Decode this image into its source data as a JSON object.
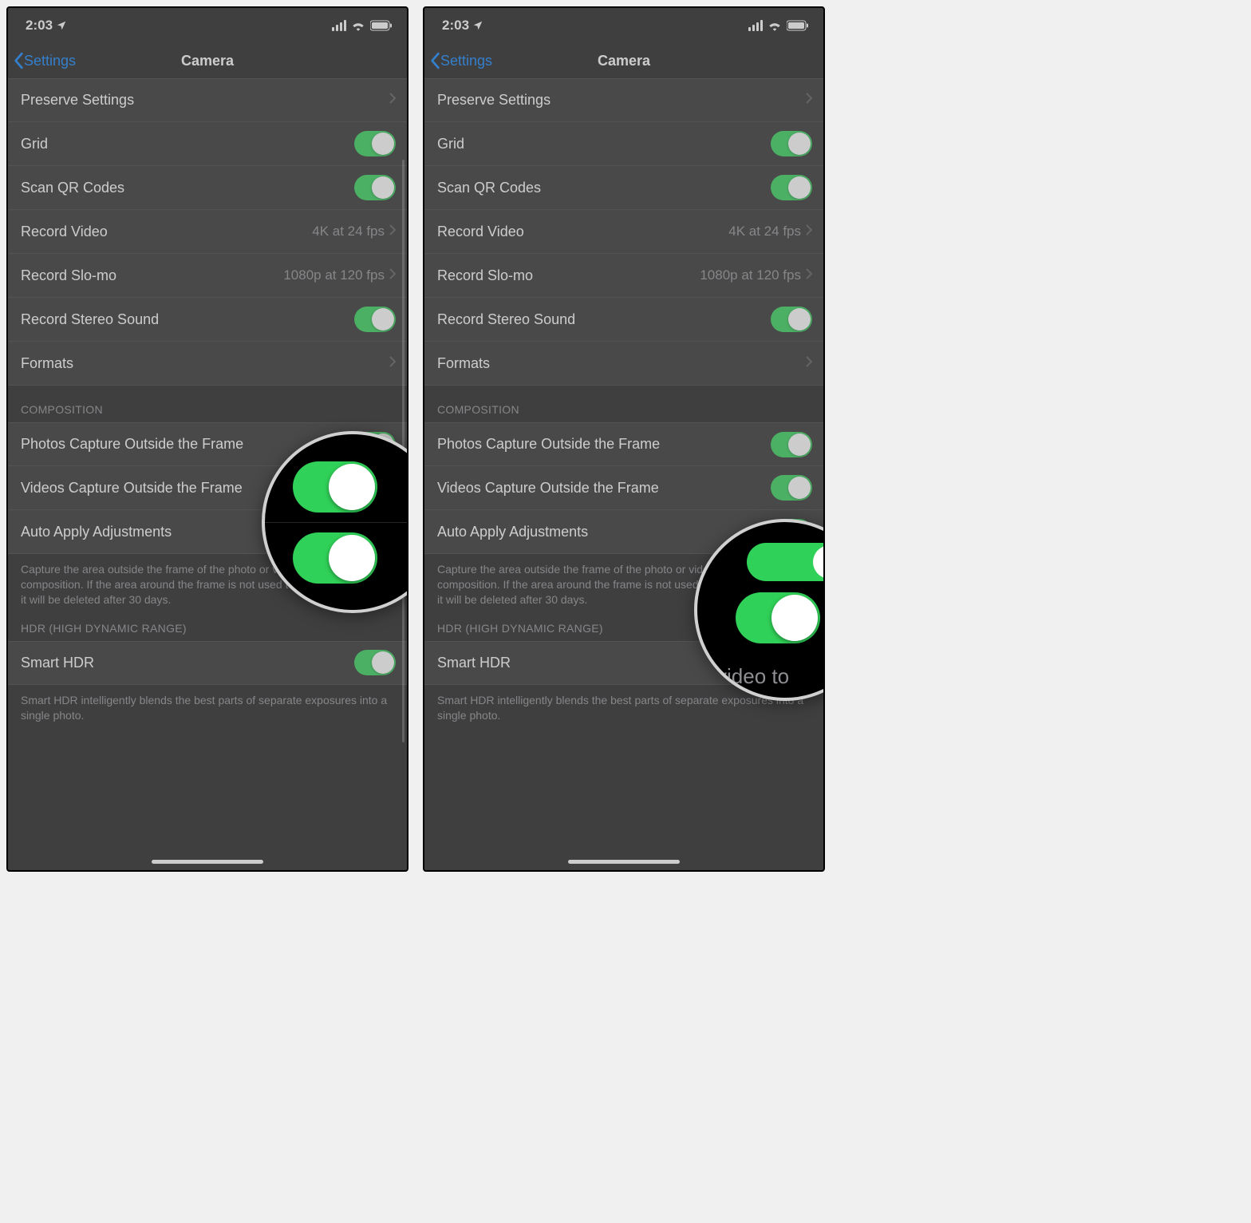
{
  "status": {
    "time": "2:03"
  },
  "nav": {
    "back": "Settings",
    "title": "Camera"
  },
  "rows": {
    "preserve": "Preserve Settings",
    "grid": "Grid",
    "scanqr": "Scan QR Codes",
    "recvideo": "Record Video",
    "recvideo_val": "4K at 24 fps",
    "slomo": "Record Slo-mo",
    "slomo_val": "1080p at 120 fps",
    "stereo": "Record Stereo Sound",
    "formats": "Formats"
  },
  "sections": {
    "composition": "COMPOSITION",
    "hdr": "HDR (HIGH DYNAMIC RANGE)"
  },
  "comp": {
    "photos": "Photos Capture Outside the Frame",
    "videos": "Videos Capture Outside the Frame",
    "auto": "Auto Apply Adjustments",
    "footer": "Capture the area outside the frame of the photo or video to improve composition. If the area around the frame is not used to make corrections, it will be deleted after 30 days."
  },
  "hdr": {
    "smart": "Smart HDR",
    "footer": "Smart HDR intelligently blends the best parts of separate exposures into a single photo."
  },
  "mag_b_caption": "video to"
}
